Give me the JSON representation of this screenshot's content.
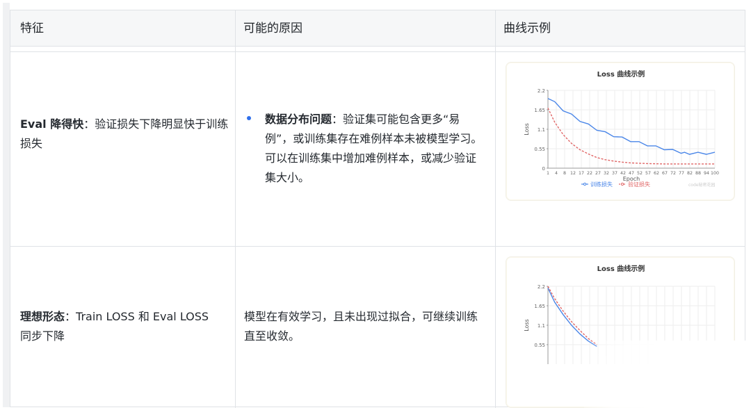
{
  "table": {
    "headers": [
      "特征",
      "可能的原因",
      "曲线示例"
    ],
    "rows": [
      {
        "feature_bold": "Eval 降得快",
        "feature_rest": "：验证损失下降明显快于训练损失",
        "reason_bold": "数据分布问题",
        "reason_rest": "：验证集可能包含更多“易例”，或训练集存在难例样本未被模型学习。 可以在训练集中增加难例样本，或减少验证集大小。"
      },
      {
        "feature_bold": "理想形态",
        "feature_rest": "：Train LOSS 和 Eval LOSS 同步下降",
        "reason": "模型在有效学习，且未出现过拟合，可继续训练直至收敛。"
      }
    ]
  },
  "charts_text": {
    "title": "Loss 曲线示例",
    "ylabel": "Loss",
    "xlabel": "Epoch",
    "legend_train": "训练损失",
    "legend_eval": "验证损失",
    "watermark": "code秘密花园"
  },
  "colors": {
    "train": "#4a86e8",
    "eval": "#e06666",
    "accent": "#2f6feb"
  },
  "chart_data": [
    {
      "type": "line",
      "title": "Loss 曲线示例",
      "xlabel": "Epoch",
      "ylabel": "Loss",
      "ylim": [
        0,
        2.2
      ],
      "xlim": [
        1,
        100
      ],
      "yticks": [
        "0",
        "0.55",
        "1.1",
        "1.65",
        "2.2"
      ],
      "xticks": [
        "1",
        "4",
        "8",
        "12",
        "17",
        "22",
        "27",
        "32",
        "37",
        "42",
        "47",
        "52",
        "57",
        "62",
        "67",
        "72",
        "77",
        "82",
        "88",
        "94",
        "100"
      ],
      "grid": true,
      "legend": "bottom",
      "series": [
        {
          "name": "训练损失",
          "style": "solid",
          "color": "#4a86e8",
          "x": [
            1,
            5,
            10,
            15,
            20,
            25,
            30,
            35,
            40,
            45,
            50,
            55,
            60,
            65,
            70,
            75,
            80,
            82,
            85,
            90,
            95,
            100
          ],
          "y": [
            2.0,
            1.85,
            1.65,
            1.5,
            1.35,
            1.22,
            1.1,
            1.0,
            0.92,
            0.85,
            0.78,
            0.72,
            0.66,
            0.6,
            0.55,
            0.5,
            0.45,
            0.42,
            0.42,
            0.42,
            0.42,
            0.42
          ]
        },
        {
          "name": "验证损失",
          "style": "dashed",
          "color": "#e06666",
          "x": [
            1,
            5,
            10,
            15,
            20,
            25,
            30,
            35,
            40,
            45,
            50,
            60,
            70,
            80,
            90,
            100
          ],
          "y": [
            1.7,
            1.3,
            0.95,
            0.7,
            0.52,
            0.4,
            0.3,
            0.24,
            0.2,
            0.17,
            0.15,
            0.13,
            0.12,
            0.12,
            0.12,
            0.12
          ]
        }
      ]
    },
    {
      "type": "line",
      "title": "Loss 曲线示例",
      "ylabel": "Loss",
      "ylim": [
        0,
        2.2
      ],
      "xlim": [
        1,
        100
      ],
      "yticks": [
        "0.55",
        "1.1",
        "1.65",
        "2.2"
      ],
      "grid": true,
      "series": [
        {
          "name": "训练损失",
          "style": "solid",
          "color": "#4a86e8",
          "x": [
            1,
            5,
            10,
            15,
            20,
            25,
            30
          ],
          "y": [
            2.15,
            1.75,
            1.4,
            1.1,
            0.85,
            0.65,
            0.5
          ]
        },
        {
          "name": "验证损失",
          "style": "dashed",
          "color": "#e06666",
          "x": [
            1,
            5,
            10,
            15,
            20,
            25,
            30
          ],
          "y": [
            2.2,
            1.85,
            1.5,
            1.2,
            0.95,
            0.72,
            0.55
          ]
        }
      ]
    }
  ]
}
